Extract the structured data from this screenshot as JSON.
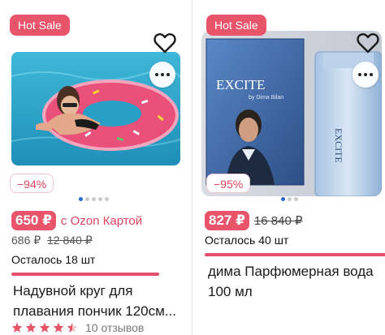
{
  "cards": [
    {
      "badge": "Hot Sale",
      "discount": "−94%",
      "price": "650 ₽",
      "ozon_note": "с Ozon Картой",
      "old_prices": {
        "price1": "686 ₽",
        "price2": "12 840 ₽"
      },
      "stock": "Осталось 18 шт",
      "stock_fill": 0.88,
      "title": "Надувной круг для плавания пончик 120см...",
      "rating": {
        "stars": 4.5,
        "reviews": "10 отзывов"
      },
      "gallery": {
        "dots": 5,
        "active_index": 0
      },
      "image_semantic": "woman on donut swim ring in pool"
    },
    {
      "badge": "Hot Sale",
      "discount": "−95%",
      "price": "827 ₽",
      "old_price": "16 840 ₽",
      "stock": "Осталось 40 шт",
      "stock_fill": 1.0,
      "title": "дима Парфюмерная вода 100 мл",
      "gallery": {
        "dots": 3,
        "active_index": 0
      },
      "image_semantic": "Excite by Dima Bilan perfume box and bottle",
      "image_text": {
        "brand": "EXCITE",
        "sub": "by Dima Bilan"
      }
    }
  ],
  "colors": {
    "accent": "#e8546a",
    "dot_active": "#2b67d1",
    "star": "#e8546a"
  },
  "icons": {
    "favorite": "heart-outline-icon",
    "more": "more-dots-icon",
    "rating": "star-icon"
  }
}
